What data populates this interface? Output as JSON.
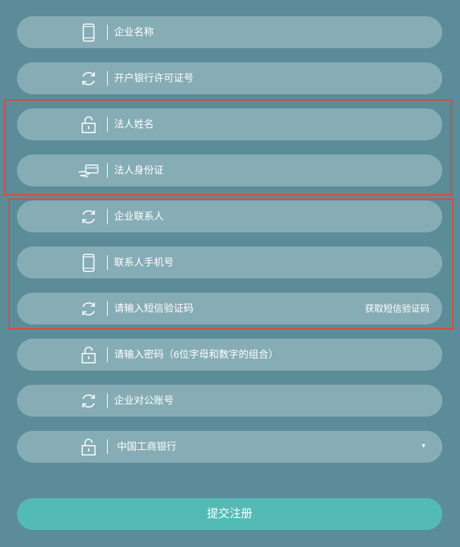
{
  "form": {
    "fields": [
      {
        "placeholder": "企业名称",
        "icon": "phone-icon"
      },
      {
        "placeholder": "开户银行许可证号",
        "icon": "refresh-icon"
      },
      {
        "placeholder": "法人姓名",
        "icon": "lock-icon"
      },
      {
        "placeholder": "法人身份证",
        "icon": "id-card-hand-icon"
      },
      {
        "placeholder": "企业联系人",
        "icon": "refresh-icon"
      },
      {
        "placeholder": "联系人手机号",
        "icon": "phone-icon"
      },
      {
        "placeholder": "请输入短信验证码",
        "icon": "refresh-icon"
      },
      {
        "placeholder": "请输入密码（6位字母和数字的组合）",
        "icon": "lock-icon"
      },
      {
        "placeholder": "企业对公账号",
        "icon": "refresh-icon"
      }
    ],
    "sms_button_label": "获取短信验证码",
    "bank_select": {
      "value": "中国工商银行",
      "icon": "lock-icon",
      "caret": "▾"
    },
    "submit_label": "提交注册"
  },
  "colors": {
    "background": "#5b8c98",
    "field_bg": "#86adb6",
    "submit_bg": "#54bab6",
    "highlight_border": "#e0463f",
    "text": "#ffffff"
  }
}
